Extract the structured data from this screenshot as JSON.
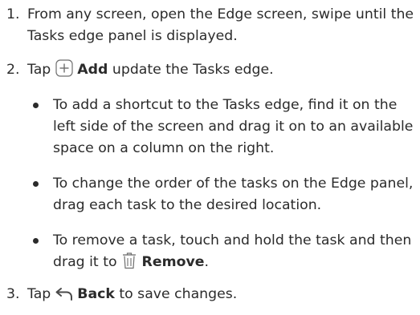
{
  "steps": [
    {
      "number": "1.",
      "text": "From any screen, open the Edge screen, swipe until the Tasks edge panel is displayed."
    },
    {
      "number": "2.",
      "before": "Tap",
      "icon": "add-icon",
      "action": "Add",
      "after": "update the Tasks edge.",
      "bullets": [
        {
          "text": "To add a shortcut to the Tasks edge, find it on the left side of the screen and drag it on to an available space on a column on the right."
        },
        {
          "text": "To change the order of the tasks on the Edge panel, drag each task to the desired location."
        },
        {
          "before": "To remove a task, touch and hold the task and then drag it to",
          "icon": "trash-icon",
          "action": "Remove",
          "after": "."
        }
      ]
    },
    {
      "number": "3.",
      "before": "Tap",
      "icon": "back-icon",
      "action": "Back",
      "after": "to save changes."
    }
  ]
}
